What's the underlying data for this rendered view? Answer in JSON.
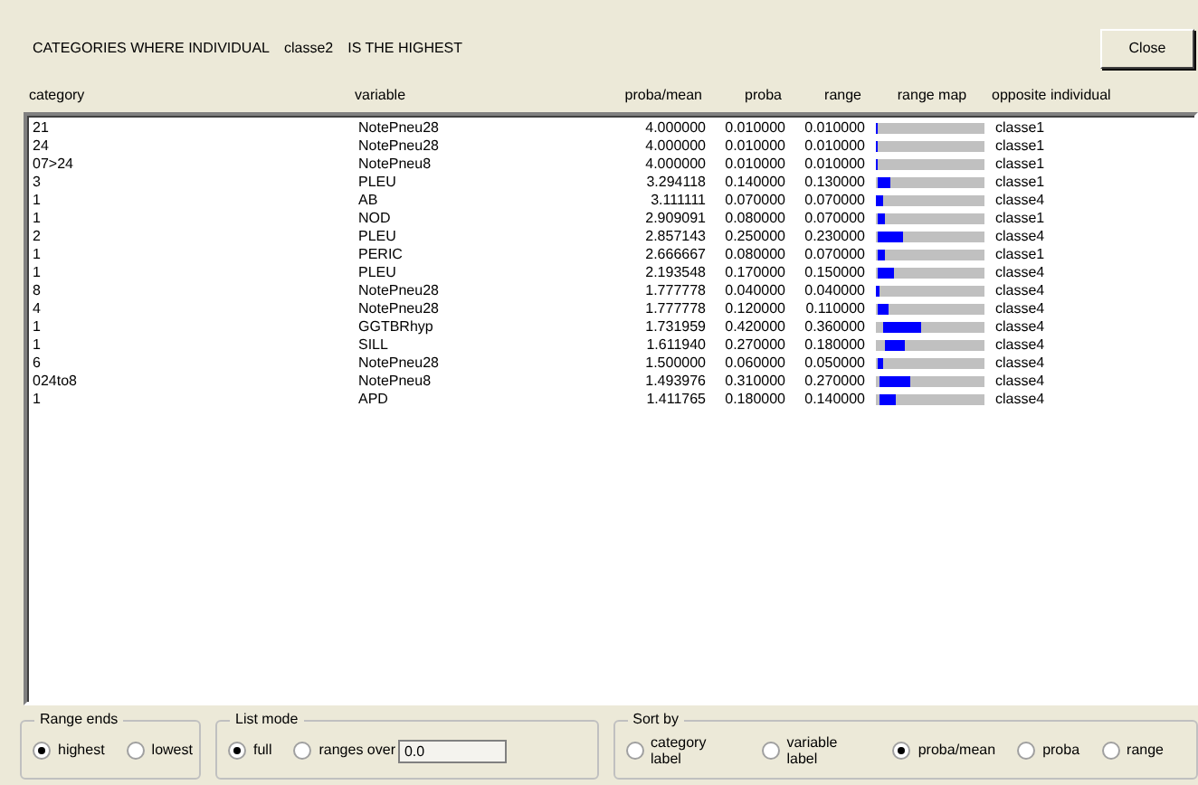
{
  "header": {
    "title_prefix": "CATEGORIES WHERE INDIVIDUAL",
    "individual": "classe2",
    "title_suffix": "IS THE HIGHEST",
    "close": "Close"
  },
  "columns": [
    "category",
    "variable",
    "proba/mean",
    "proba",
    "range",
    "range map",
    "opposite individual"
  ],
  "rows": [
    {
      "category": "21",
      "variable": "NotePneu28",
      "proba_mean": "4.000000",
      "proba": "0.010000",
      "range": "0.010000",
      "opposite": "classe1"
    },
    {
      "category": "24",
      "variable": "NotePneu28",
      "proba_mean": "4.000000",
      "proba": "0.010000",
      "range": "0.010000",
      "opposite": "classe1"
    },
    {
      "category": "07>24",
      "variable": "NotePneu8",
      "proba_mean": "4.000000",
      "proba": "0.010000",
      "range": "0.010000",
      "opposite": "classe1"
    },
    {
      "category": "3",
      "variable": "PLEU",
      "proba_mean": "3.294118",
      "proba": "0.140000",
      "range": "0.130000",
      "opposite": "classe1"
    },
    {
      "category": "1",
      "variable": "AB",
      "proba_mean": "3.111111",
      "proba": "0.070000",
      "range": "0.070000",
      "opposite": "classe4"
    },
    {
      "category": "1",
      "variable": "NOD",
      "proba_mean": "2.909091",
      "proba": "0.080000",
      "range": "0.070000",
      "opposite": "classe1"
    },
    {
      "category": "2",
      "variable": "PLEU",
      "proba_mean": "2.857143",
      "proba": "0.250000",
      "range": "0.230000",
      "opposite": "classe4"
    },
    {
      "category": "1",
      "variable": "PERIC",
      "proba_mean": "2.666667",
      "proba": "0.080000",
      "range": "0.070000",
      "opposite": "classe1"
    },
    {
      "category": "1",
      "variable": "PLEU",
      "proba_mean": "2.193548",
      "proba": "0.170000",
      "range": "0.150000",
      "opposite": "classe4"
    },
    {
      "category": "8",
      "variable": "NotePneu28",
      "proba_mean": "1.777778",
      "proba": "0.040000",
      "range": "0.040000",
      "opposite": "classe4"
    },
    {
      "category": "4",
      "variable": "NotePneu28",
      "proba_mean": "1.777778",
      "proba": "0.120000",
      "range": "0.110000",
      "opposite": "classe4"
    },
    {
      "category": "1",
      "variable": "GGTBRhyp",
      "proba_mean": "1.731959",
      "proba": "0.420000",
      "range": "0.360000",
      "opposite": "classe4"
    },
    {
      "category": "1",
      "variable": "SILL",
      "proba_mean": "1.611940",
      "proba": "0.270000",
      "range": "0.180000",
      "opposite": "classe4"
    },
    {
      "category": "6",
      "variable": "NotePneu28",
      "proba_mean": "1.500000",
      "proba": "0.060000",
      "range": "0.050000",
      "opposite": "classe4"
    },
    {
      "category": "024to8",
      "variable": "NotePneu8",
      "proba_mean": "1.493976",
      "proba": "0.310000",
      "range": "0.270000",
      "opposite": "classe4"
    },
    {
      "category": "1",
      "variable": "APD",
      "proba_mean": "1.411765",
      "proba": "0.180000",
      "range": "0.140000",
      "opposite": "classe4"
    }
  ],
  "range_ends": {
    "title": "Range ends",
    "options": [
      {
        "label": "highest",
        "selected": true
      },
      {
        "label": "lowest",
        "selected": false
      }
    ]
  },
  "list_mode": {
    "title": "List mode",
    "options": [
      {
        "label": "full",
        "selected": true
      },
      {
        "label": "ranges over",
        "selected": false
      }
    ],
    "value": "0.0"
  },
  "sort_by": {
    "title": "Sort by",
    "options": [
      {
        "label": "category label",
        "selected": false
      },
      {
        "label": "variable label",
        "selected": false
      },
      {
        "label": "proba/mean",
        "selected": true
      },
      {
        "label": "proba",
        "selected": false
      },
      {
        "label": "range",
        "selected": false
      }
    ]
  }
}
